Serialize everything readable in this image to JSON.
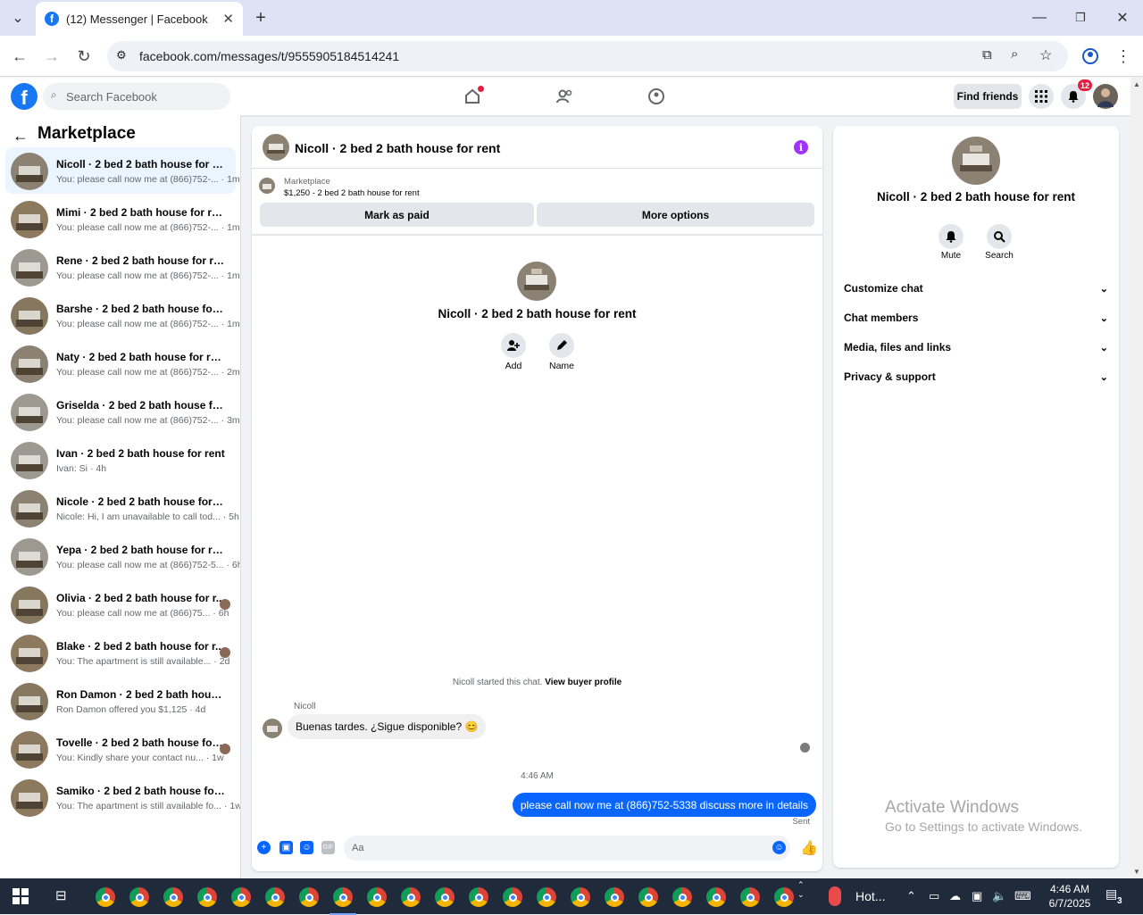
{
  "browser": {
    "tab_title": "(12) Messenger | Facebook",
    "url": "facebook.com/messages/t/9555905184514241"
  },
  "header": {
    "search_placeholder": "Search Facebook",
    "find_friends": "Find friends",
    "notification_count": "12",
    "accent": "#1877f2"
  },
  "sidebar": {
    "title": "Marketplace",
    "conversations": [
      {
        "title": "Nicoll · 2 bed 2 bath house for rent",
        "preview": "You: please call now me at (866)752-...",
        "time": "· 1m",
        "thumb": "#8c8273"
      },
      {
        "title": "Mimi · 2 bed 2 bath house for rent",
        "preview": "You: please call now me at (866)752-...",
        "time": "· 1m",
        "thumb": "#8d7a5e"
      },
      {
        "title": "Rene · 2 bed 2 bath house for rent",
        "preview": "You: please call now me at (866)752-...",
        "time": "· 1m",
        "thumb": "#9d9890"
      },
      {
        "title": "Barshe · 2 bed 2 bath house for rent",
        "preview": "You: please call now me at (866)752-...",
        "time": "· 1m",
        "thumb": "#86785f"
      },
      {
        "title": "Naty · 2 bed 2 bath house for rent",
        "preview": "You: please call now me at (866)752-...",
        "time": "· 2m",
        "thumb": "#8c8273"
      },
      {
        "title": "Griselda · 2 bed 2 bath house for r...",
        "preview": "You: please call now me at (866)752-...",
        "time": "· 3m",
        "thumb": "#9d9890"
      },
      {
        "title": "Ivan · 2 bed 2 bath house for rent",
        "preview": "Ivan: Si",
        "time": "· 4h",
        "thumb": "#9d9890"
      },
      {
        "title": "Nicole · 2 bed 2 bath house for rent",
        "preview": "Nicole: Hi, I am unavailable to call tod...",
        "time": "· 5h",
        "thumb": "#8c8273"
      },
      {
        "title": "Yepa · 2 bed 2 bath house for rent",
        "preview": "You: please call now me at (866)752-5...",
        "time": "· 6h",
        "thumb": "#9d9890"
      },
      {
        "title": "Olivia · 2 bed 2 bath house for r...",
        "preview": "You: please call now me at (866)75...",
        "time": "· 6h",
        "thumb": "#86785f"
      },
      {
        "title": "Blake · 2 bed 2 bath house for r...",
        "preview": "You: The apartment is still available...",
        "time": "· 2d",
        "thumb": "#8d7a5e"
      },
      {
        "title": "Ron Damon · 2 bed 2 bath house f...",
        "preview": "Ron Damon offered you $1,125",
        "time": "· 4d",
        "thumb": "#86785f"
      },
      {
        "title": "Tovelle · 2 bed 2 bath house for ...",
        "preview": "You: Kindly share your contact nu...",
        "time": "· 1w",
        "thumb": "#8d7a5e"
      },
      {
        "title": "Samiko · 2 bed 2 bath house for re...",
        "preview": "You: The apartment is still available fo...",
        "time": "· 1w",
        "thumb": "#8d7a5e"
      }
    ]
  },
  "chat": {
    "title": "Nicoll · 2 bed 2 bath house for rent",
    "listing_source": "Marketplace",
    "listing_text": "$1,250 - 2 bed 2 bath house for rent",
    "mark_paid": "Mark as paid",
    "more_options": "More options",
    "center_name": "Nicoll · 2 bed 2 bath house for rent",
    "add_label": "Add",
    "name_label": "Name",
    "started_text": "Nicoll started this chat.",
    "view_buyer": "View buyer profile",
    "sender_name": "Nicoll",
    "incoming_message": "Buenas tardes. ¿Sigue disponible? 😊",
    "timestamp": "4:46 AM",
    "outgoing_message": "please call now me at (866)752-5338 discuss more in details",
    "sent_status": "Sent",
    "input_placeholder": "Aa",
    "outgoing_color": "#0866ff"
  },
  "details": {
    "name": "Nicoll · 2 bed 2 bath house for rent",
    "mute": "Mute",
    "search": "Search",
    "sections": [
      "Customize chat",
      "Chat members",
      "Media, files and links",
      "Privacy & support"
    ]
  },
  "watermark": {
    "line1": "Activate Windows",
    "line2": "Go to Settings to activate Windows."
  },
  "taskbar": {
    "tray_text": "Hot...",
    "time": "4:46 AM",
    "date": "6/7/2025",
    "notif_count": "3"
  }
}
